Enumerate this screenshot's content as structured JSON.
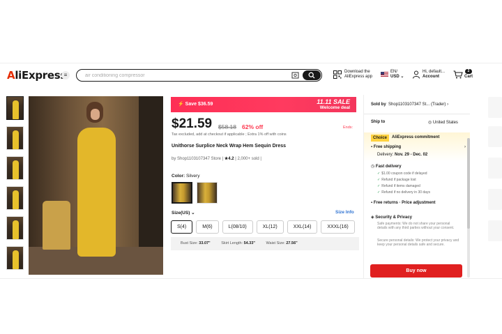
{
  "header": {
    "logo": "AliExpress",
    "search_placeholder": "air conditioning compressor",
    "download_line1": "Download the",
    "download_line2": "AliExpress app",
    "lang_line1": "EN/",
    "lang_line2": "USD ⌄",
    "account_line1": "Hi, default...",
    "account_line2": "Account",
    "cart_count": "2",
    "cart_label": "Cart"
  },
  "promo": {
    "save": "Save $36.59",
    "sale_line1": "11.11 SALE",
    "sale_line2": "Welcome deal"
  },
  "product": {
    "price": "$21.59",
    "old_price": "$58.18",
    "discount": "62% off",
    "ends": "Ends:",
    "tax_note": "Tax excluded, add at checkout if applicable ; Extra 1% off with coins",
    "title": "Unithorse Surplice Neck Wrap Hem Sequin Dress",
    "store_prefix": "by ",
    "store_name": "Shop1103107347 Store",
    "rating_sep": " | ",
    "rating": "★4.2",
    "sold": " | 2,000+ sold |",
    "color_label": "Color: ",
    "color_value": "Silvery",
    "size_label": "Size(US) ⌄",
    "size_info": "Size Info",
    "sizes": [
      "S(4)",
      "M(6)",
      "L(08/10)",
      "XL(12)",
      "XXL(14)",
      "XXXL(16)"
    ],
    "bust_label": "Bust Size: ",
    "bust_value": "33.07\"",
    "skirt_label": "Skirt Length: ",
    "skirt_value": "54.33\"",
    "waist_label": "Waist Size: ",
    "waist_value": "27.56\""
  },
  "panel": {
    "sold_by_label": "Sold by",
    "sold_by_value": "Shop1103107347 St... (Trader) ›",
    "ship_to": "Ship to",
    "ship_country": "◎ United States",
    "choice_badge": "Choice",
    "choice_text": "AliExpress commitment",
    "free_shipping": "Free shipping",
    "delivery_label": "Delivery: ",
    "delivery_value": "Nov. 29 - Dec. 02",
    "fast_delivery": "Fast delivery",
    "fd_items": [
      "$1.00 coupon code if delayed",
      "Refund if package lost",
      "Refund if items damaged",
      "Refund if no delivery in 30 days"
    ],
    "free_returns": "Free returns · Price adjustment",
    "security": "Security & Privacy",
    "sec_text1": "Safe payments: We do not share your personal details with any third parties without your consent.",
    "sec_text2": "Secure personal details: We protect your privacy and keep your personal details safe and secure.",
    "buy_now": "Buy now"
  },
  "colors": {
    "accent": "#fd384f",
    "buy": "#e02020",
    "link": "#2e72d2"
  }
}
